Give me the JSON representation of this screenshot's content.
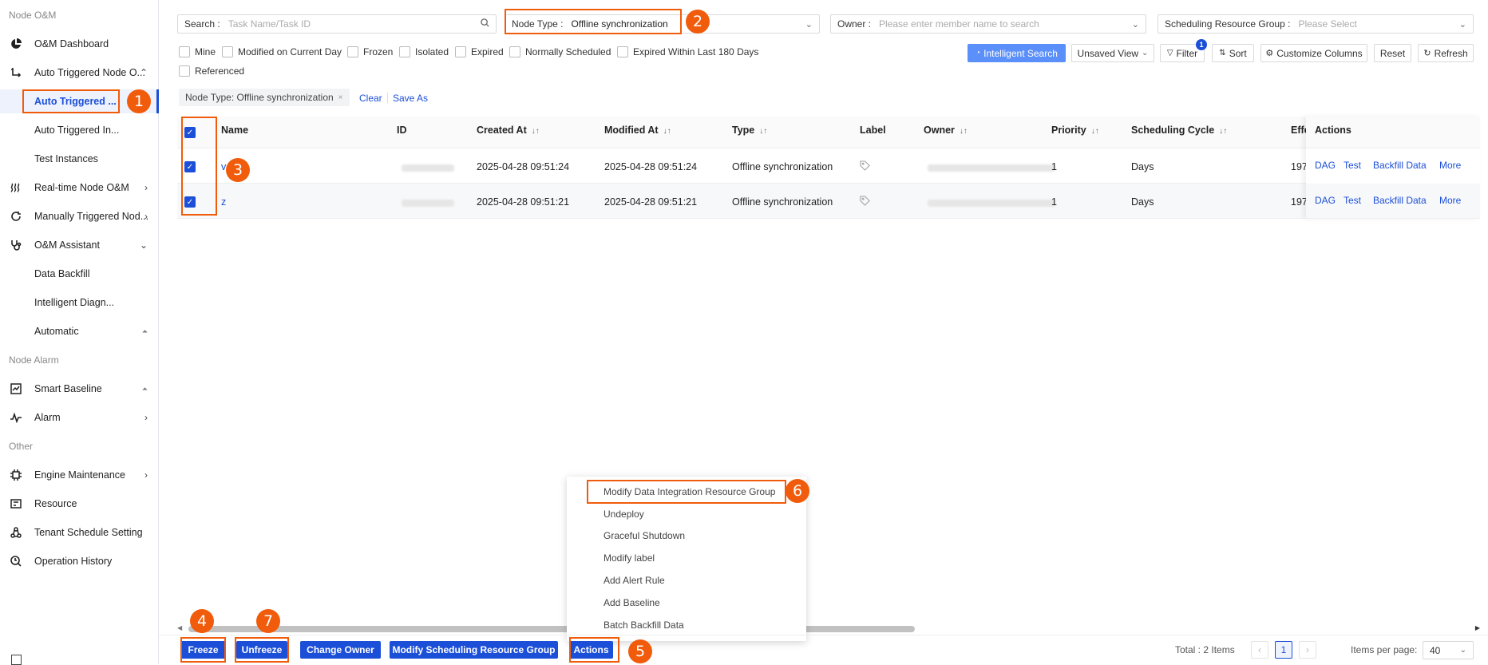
{
  "sidebar": {
    "section_node_om": "Node O&M",
    "section_node_alarm": "Node Alarm",
    "section_other": "Other",
    "items": [
      {
        "label": "O&M Dashboard",
        "icon": "pie-chart-icon"
      },
      {
        "label": "Auto Triggered Node O...",
        "icon": "flow-icon"
      },
      {
        "label": "Auto Triggered ..."
      },
      {
        "label": "Auto Triggered In..."
      },
      {
        "label": "Test Instances"
      },
      {
        "label": "Real-time Node O&M",
        "icon": "wave-icon"
      },
      {
        "label": "Manually Triggered Nod...",
        "icon": "refresh-icon"
      },
      {
        "label": "O&M Assistant",
        "icon": "stethoscope-icon"
      },
      {
        "label": "Data Backfill"
      },
      {
        "label": "Intelligent Diagn..."
      },
      {
        "label": "Automatic"
      },
      {
        "label": "Smart Baseline",
        "icon": "line-chart-icon"
      },
      {
        "label": "Alarm",
        "icon": "pulse-icon"
      },
      {
        "label": "Engine Maintenance",
        "icon": "chip-icon"
      },
      {
        "label": "Resource",
        "icon": "resource-icon"
      },
      {
        "label": "Tenant Schedule Setting",
        "icon": "cycle-icon"
      },
      {
        "label": "Operation History",
        "icon": "history-icon"
      }
    ]
  },
  "filters": {
    "search_label": "Search :",
    "search_placeholder": "Task Name/Task ID",
    "node_type_label": "Node Type :",
    "node_type_value": "Offline synchronization",
    "owner_label": "Owner :",
    "owner_placeholder": "Please enter member name to search",
    "resource_group_label": "Scheduling Resource Group :",
    "resource_group_placeholder": "Please Select"
  },
  "quick_filters": [
    "Mine",
    "Modified on Current Day",
    "Frozen",
    "Isolated",
    "Expired",
    "Normally Scheduled",
    "Expired Within Last 180 Days",
    "Referenced"
  ],
  "toolbar": {
    "intelligent_search": "Intelligent Search",
    "unsaved_view": "Unsaved View",
    "filter": "Filter",
    "filter_count": "1",
    "sort": "Sort",
    "customize_columns": "Customize Columns",
    "reset": "Reset",
    "refresh": "Refresh"
  },
  "active_filter": {
    "tag": "Node Type: Offline synchronization",
    "clear": "Clear",
    "save_as": "Save As"
  },
  "table": {
    "columns": [
      "Name",
      "ID",
      "Created At",
      "Modified At",
      "Type",
      "Label",
      "Owner",
      "Priority",
      "Scheduling Cycle",
      "Effe",
      "Actions"
    ],
    "rows": [
      {
        "name": "v",
        "created": "2025-04-28 09:51:24",
        "modified": "2025-04-28 09:51:24",
        "type": "Offline synchronization",
        "priority": "1",
        "cycle": "Days",
        "effective": "197"
      },
      {
        "name": "z",
        "created": "2025-04-28 09:51:21",
        "modified": "2025-04-28 09:51:21",
        "type": "Offline synchronization",
        "priority": "1",
        "cycle": "Days",
        "effective": "197"
      }
    ],
    "row_actions": [
      "DAG",
      "Test",
      "Backfill Data",
      "More"
    ]
  },
  "actions_menu": [
    "Modify Data Integration Resource Group",
    "Undeploy",
    "Graceful Shutdown",
    "Modify label",
    "Add Alert Rule",
    "Add Baseline",
    "Batch Backfill Data"
  ],
  "bottom_bar": {
    "freeze": "Freeze",
    "unfreeze": "Unfreeze",
    "change_owner": "Change Owner",
    "modify_resource_group": "Modify Scheduling Resource Group",
    "actions": "Actions",
    "total": "Total : 2 Items",
    "page": "1",
    "items_per_page_label": "Items per page:",
    "items_per_page": "40"
  },
  "callouts": [
    "1",
    "2",
    "3",
    "4",
    "5",
    "6",
    "7"
  ],
  "colors": {
    "accent": "#1c4fd8",
    "highlight": "#f05c0b",
    "intelligent_search": "#5b8ff9"
  }
}
